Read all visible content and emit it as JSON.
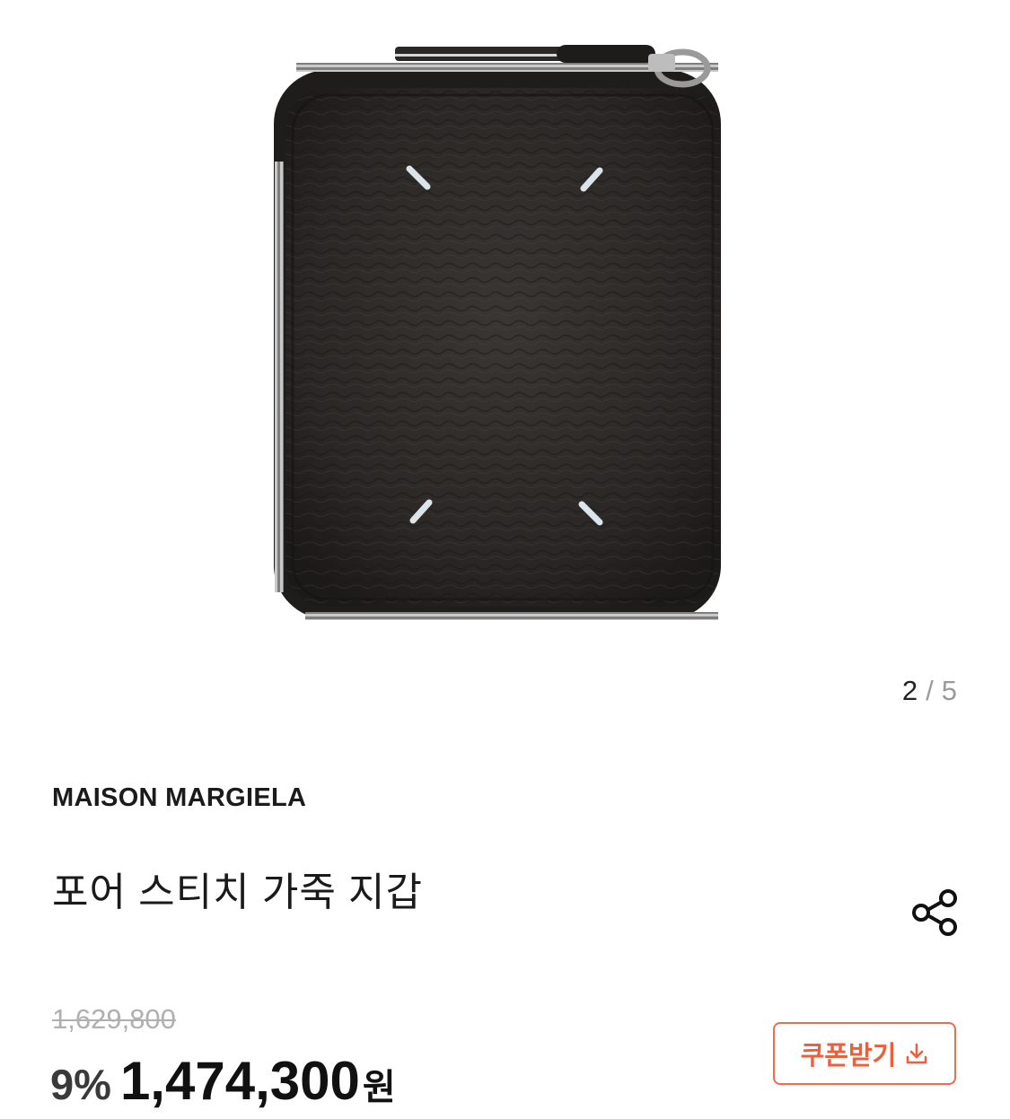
{
  "gallery": {
    "current": "2",
    "separator": "/",
    "total": "5",
    "image_alt": "black leather zip-around wallet with four white stitches"
  },
  "product": {
    "brand": "MAISON MARGIELA",
    "title": "포어 스티치 가죽 지갑"
  },
  "pricing": {
    "original_price": "1,629,800",
    "discount_rate": "9%",
    "sale_price": "1,474,300",
    "currency": "원"
  },
  "coupon": {
    "label": "쿠폰받기",
    "icon": "download-icon",
    "accent_color": "#ec5f3c"
  },
  "share": {
    "icon": "share-icon"
  }
}
